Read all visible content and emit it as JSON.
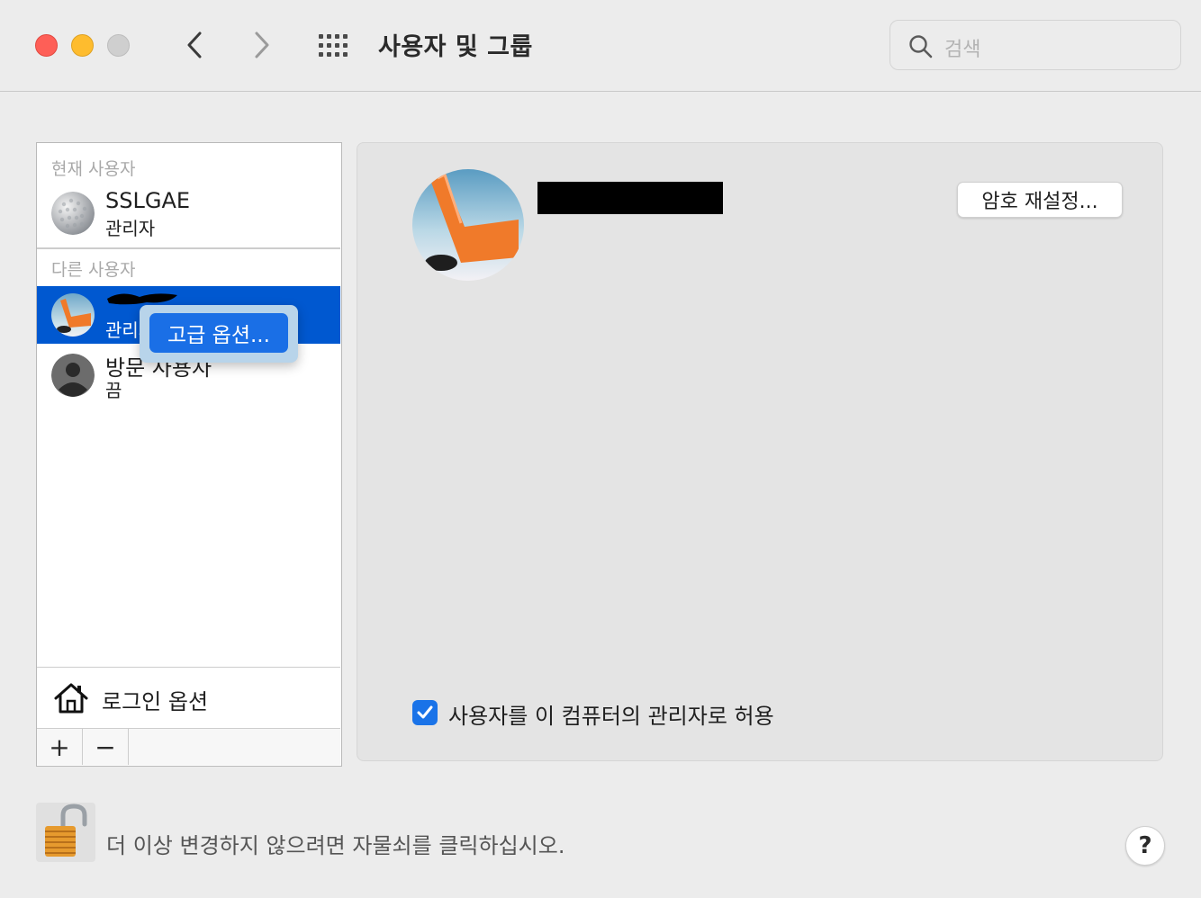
{
  "window": {
    "title": "사용자 및 그룹",
    "search_placeholder": "검색"
  },
  "sidebar": {
    "current_section": "현재 사용자",
    "other_section": "다른 사용자",
    "current_user": {
      "name": "SSLGAE",
      "role": "관리자"
    },
    "other_users": [
      {
        "name": "",
        "role": "관리자",
        "selected": true,
        "name_redacted": true
      },
      {
        "name": "방문 사용자",
        "role": "끔",
        "selected": false
      }
    ],
    "login_options_label": "로그인 옵션",
    "add_label": "+",
    "remove_label": "−"
  },
  "popover": {
    "button_label": "고급 옵션..."
  },
  "detail": {
    "reset_password_label": "암호 재설정...",
    "admin_checkbox_label": "사용자를 이 컴퓨터의 관리자로 허용",
    "admin_checked": true
  },
  "footer": {
    "lock_text": "더 이상 변경하지 않으려면 자물쇠를 클릭하십시오.",
    "help_label": "?"
  },
  "colors": {
    "selection": "#0058d0",
    "accent": "#1a73e8"
  }
}
